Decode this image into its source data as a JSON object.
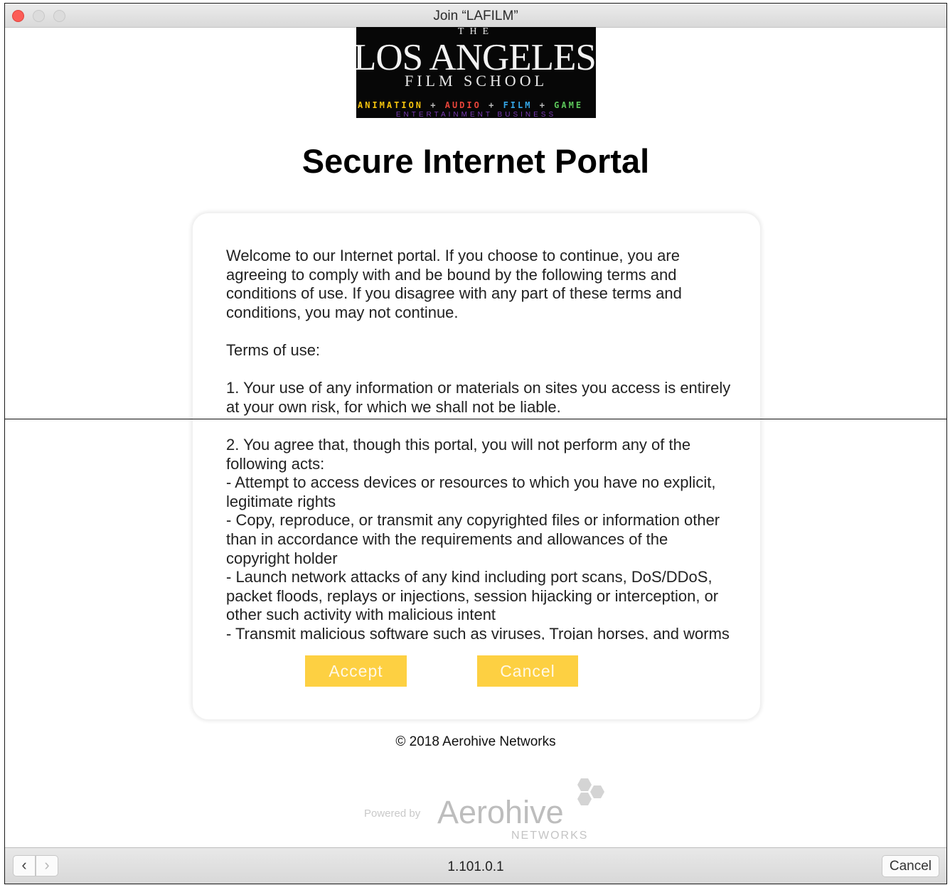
{
  "window": {
    "title": "Join “LAFILM”"
  },
  "logo": {
    "the": "THE",
    "name": "LOS ANGELES",
    "subtitle": "FILM SCHOOL",
    "disciplines": [
      "ANIMATION",
      "AUDIO",
      "FILM",
      "GAME"
    ],
    "discipline_colors": [
      "#f4c20d",
      "#e8443a",
      "#35a7e8",
      "#5cc65a"
    ],
    "separator": "+",
    "tagline": "ENTERTAINMENT BUSINESS"
  },
  "portal": {
    "heading": "Secure Internet Portal",
    "intro": "Welcome to our Internet portal. If you choose to continue, you are agreeing to comply with and be bound by the following terms and conditions of use. If you disagree with any part of these terms and conditions, you may not continue.",
    "terms_heading": "Terms of use:",
    "term_1": "1. Your use of any information or materials on sites you access is entirely at your own risk, for which we shall not be liable.",
    "term_2": "2. You agree that, though this portal, you will not perform any of the following acts:",
    "acts": [
      "- Attempt to access devices or resources to which you have no explicit, legitimate rights",
      "- Copy, reproduce, or transmit any copyrighted files or information other than in accordance with the requirements and allowances of the copyright holder",
      "- Launch network attacks of any kind including port scans, DoS/DDoS, packet floods, replays or injections, session hijacking or interception, or other such activity with malicious intent",
      "- Transmit malicious software such as viruses, Trojan horses, and worms"
    ],
    "accept_label": "Accept",
    "cancel_label": "Cancel",
    "button_color": "#fdd042"
  },
  "footer": {
    "copyright": "© 2018 Aerohive Networks",
    "powered_by": "Powered by",
    "brand": "Aerohive",
    "brand_sub": "NETWORKS"
  },
  "toolbar": {
    "back_icon": "chevron-left-icon",
    "forward_icon": "chevron-right-icon",
    "address": "1.101.0.1",
    "cancel_label": "Cancel"
  }
}
